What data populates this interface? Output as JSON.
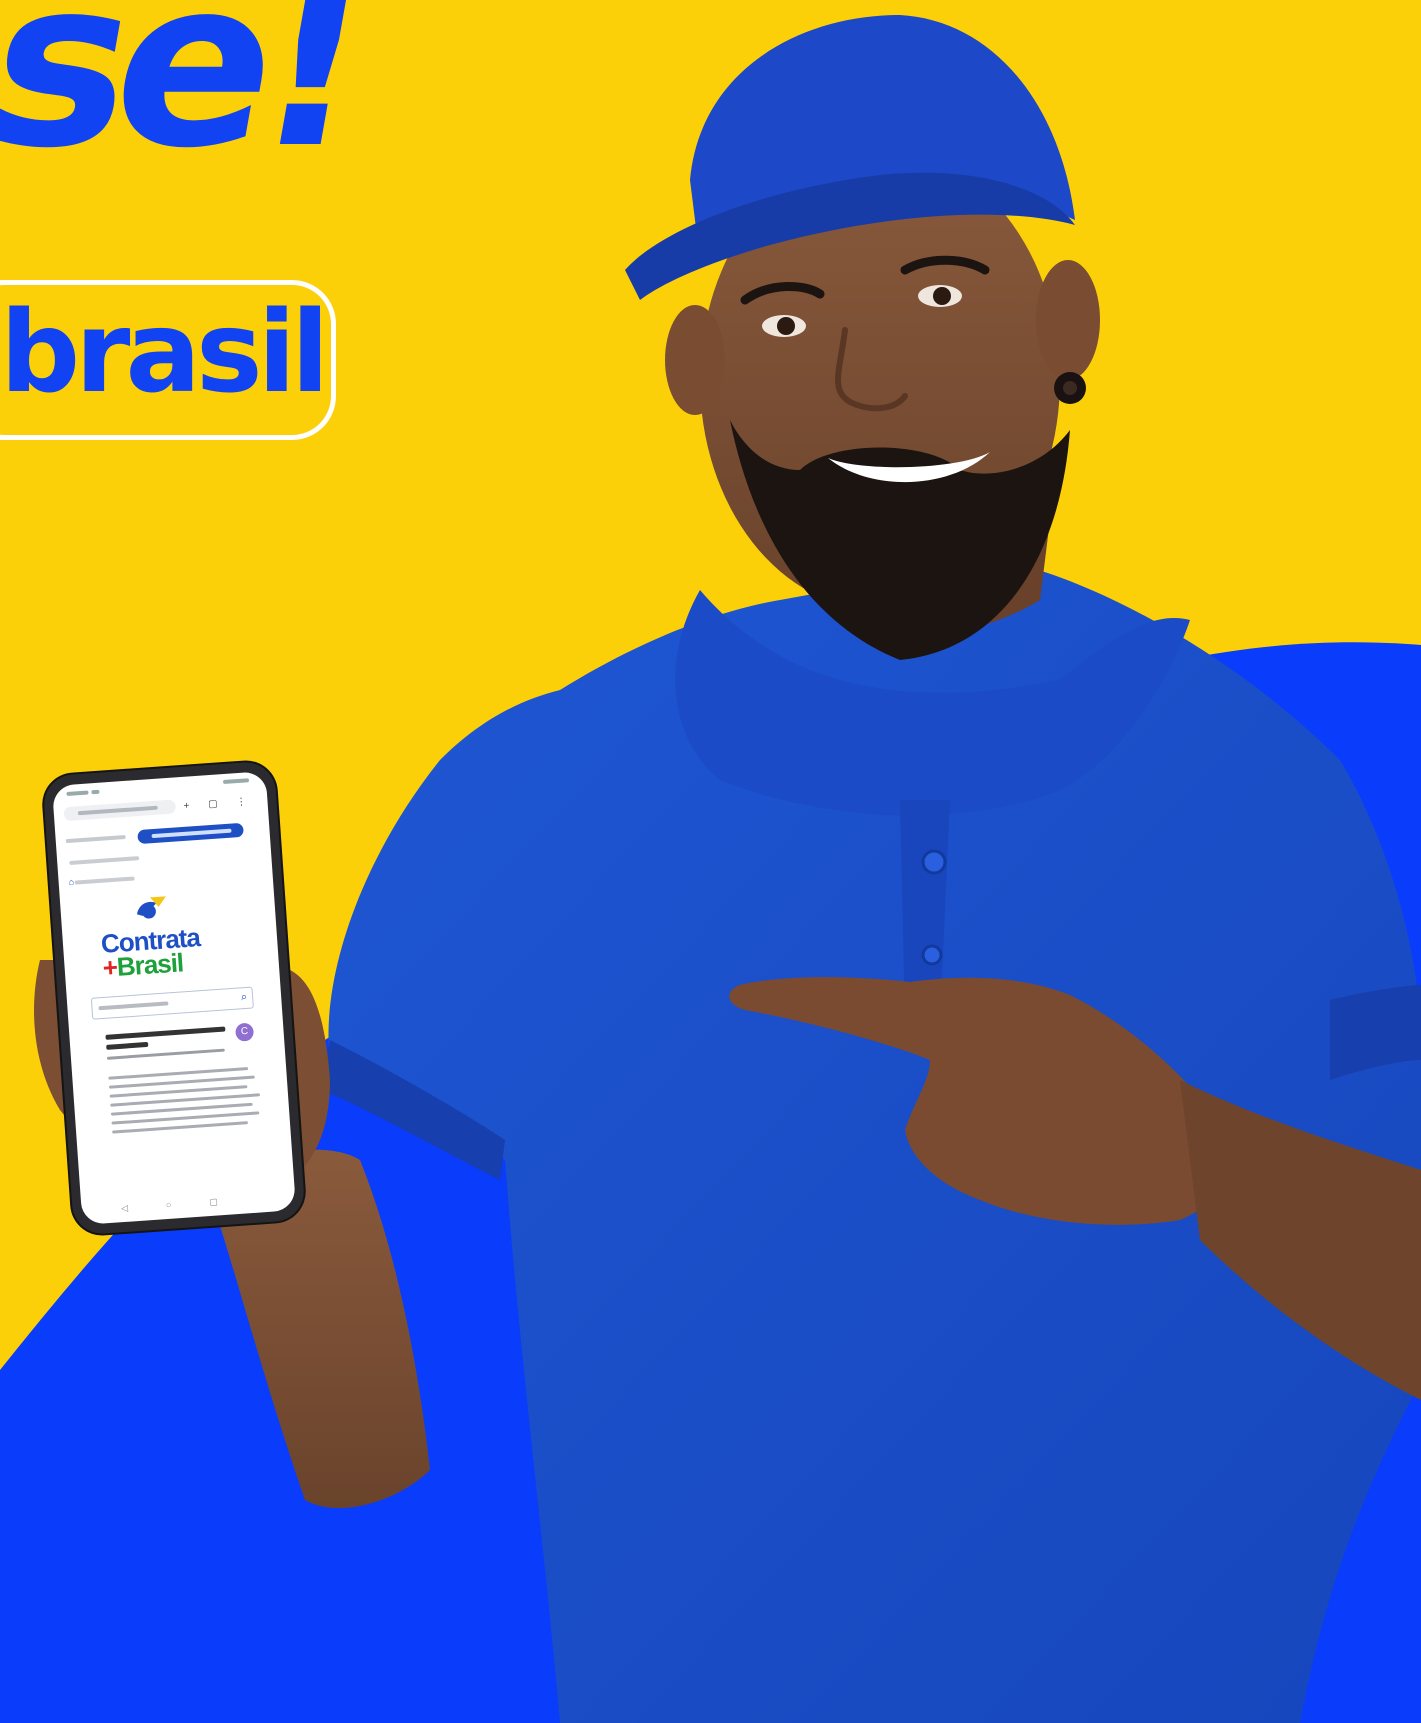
{
  "scene": {
    "background_yellow": "#fcd008",
    "background_blue": "#0a3cfb",
    "shirt_color": "#1a4fc9",
    "cap_color": "#1d48c7",
    "description_subject": "man in blue cap and polo holding phone and pointing"
  },
  "headline": {
    "text": "se!"
  },
  "address_pill": {
    "text": "brasil"
  },
  "phone_screen": {
    "logo_line1": "Contrata",
    "logo_line2_plus": "+",
    "logo_line2": "Brasil",
    "avatar_letter": "C"
  }
}
